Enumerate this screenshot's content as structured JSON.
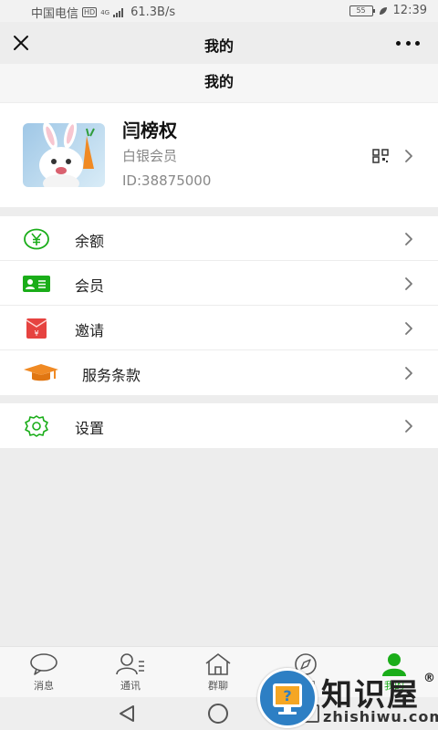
{
  "status_bar": {
    "carrier": "中国电信",
    "network_badge": "HD",
    "network_type": "4G",
    "speed": "61.3B/s",
    "battery": "55",
    "time": "12:39"
  },
  "nav": {
    "title": "我的",
    "close_icon": "close-icon",
    "more_icon": "more-icon"
  },
  "page_header": "我的",
  "profile": {
    "name": "闫榜权",
    "level": "白银会员",
    "id": "ID:38875000",
    "avatar": "rabbit-avatar"
  },
  "menu_groups": [
    [
      {
        "label": "余额",
        "icon": "yen-circle-icon",
        "color": "#1aad19"
      },
      {
        "label": "会员",
        "icon": "member-card-icon",
        "color": "#1aad19"
      },
      {
        "label": "邀请",
        "icon": "red-envelope-icon",
        "color": "#e64340"
      },
      {
        "label": "服务条款",
        "icon": "graduation-cap-icon",
        "color": "#f08a24"
      }
    ],
    [
      {
        "label": "设置",
        "icon": "gear-icon",
        "color": "#1aad19"
      }
    ]
  ],
  "tabs": [
    {
      "label": "消息",
      "icon": "chat-bubble-icon"
    },
    {
      "label": "通讯",
      "icon": "contacts-icon"
    },
    {
      "label": "群聊",
      "icon": "home-icon"
    },
    {
      "label": "发现",
      "icon": "compass-icon"
    },
    {
      "label": "我的",
      "icon": "person-icon",
      "active": true
    }
  ],
  "watermark": {
    "text": "知识屋",
    "url": "zhishiwu.com",
    "mark": "®"
  }
}
